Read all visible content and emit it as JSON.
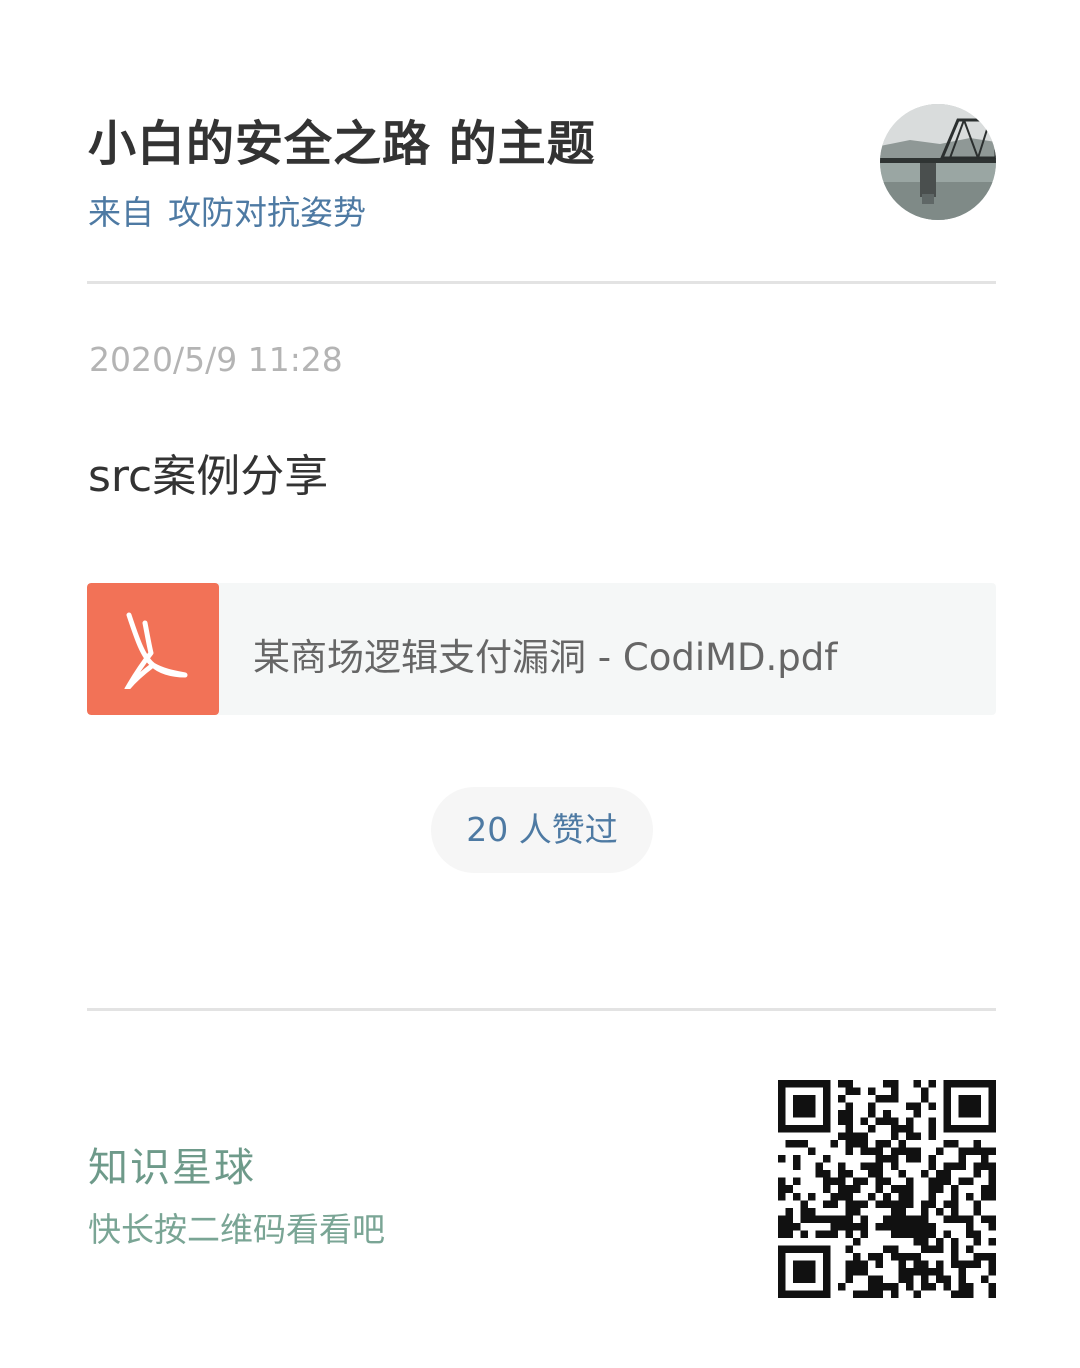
{
  "header": {
    "title": "小白的安全之路 的主题",
    "from_label": "来自",
    "group_name": "攻防对抗姿势"
  },
  "post": {
    "timestamp": "2020/5/9 11:28",
    "text": "src案例分享",
    "attachment": {
      "file_name": "某商场逻辑支付漏洞 - CodiMD.pdf",
      "icon": "pdf-icon",
      "icon_bg": "#f27257"
    },
    "likes_label": "20 人赞过"
  },
  "footer": {
    "brand": "知识星球",
    "hint": "快长按二维码看看吧"
  },
  "colors": {
    "link": "#4e7aa3",
    "brand": "#6e9a8a",
    "muted": "#b4b4b4",
    "text": "#333333"
  }
}
